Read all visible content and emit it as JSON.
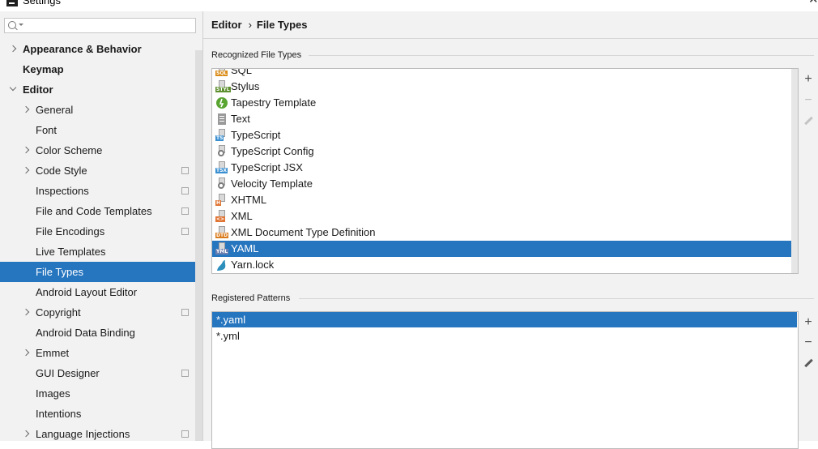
{
  "window": {
    "title": "Settings",
    "close_glyph": "✕"
  },
  "search": {
    "placeholder": "",
    "value": ""
  },
  "sidebar": {
    "items": [
      {
        "label": "Appearance & Behavior",
        "bold": true,
        "chevron": "right",
        "indent": 0,
        "proj": false
      },
      {
        "label": "Keymap",
        "bold": true,
        "chevron": "none",
        "indent": 0,
        "proj": false
      },
      {
        "label": "Editor",
        "bold": true,
        "chevron": "down",
        "indent": 0,
        "proj": false
      },
      {
        "label": "General",
        "bold": false,
        "chevron": "right",
        "indent": 1,
        "proj": false
      },
      {
        "label": "Font",
        "bold": false,
        "chevron": "none",
        "indent": 1,
        "proj": false
      },
      {
        "label": "Color Scheme",
        "bold": false,
        "chevron": "right",
        "indent": 1,
        "proj": false
      },
      {
        "label": "Code Style",
        "bold": false,
        "chevron": "right",
        "indent": 1,
        "proj": true
      },
      {
        "label": "Inspections",
        "bold": false,
        "chevron": "none",
        "indent": 1,
        "proj": true
      },
      {
        "label": "File and Code Templates",
        "bold": false,
        "chevron": "none",
        "indent": 1,
        "proj": true
      },
      {
        "label": "File Encodings",
        "bold": false,
        "chevron": "none",
        "indent": 1,
        "proj": true
      },
      {
        "label": "Live Templates",
        "bold": false,
        "chevron": "none",
        "indent": 1,
        "proj": false
      },
      {
        "label": "File Types",
        "bold": false,
        "chevron": "none",
        "indent": 1,
        "proj": false,
        "selected": true
      },
      {
        "label": "Android Layout Editor",
        "bold": false,
        "chevron": "none",
        "indent": 1,
        "proj": false
      },
      {
        "label": "Copyright",
        "bold": false,
        "chevron": "right",
        "indent": 1,
        "proj": true
      },
      {
        "label": "Android Data Binding",
        "bold": false,
        "chevron": "none",
        "indent": 1,
        "proj": false
      },
      {
        "label": "Emmet",
        "bold": false,
        "chevron": "right",
        "indent": 1,
        "proj": false
      },
      {
        "label": "GUI Designer",
        "bold": false,
        "chevron": "none",
        "indent": 1,
        "proj": true
      },
      {
        "label": "Images",
        "bold": false,
        "chevron": "none",
        "indent": 1,
        "proj": false
      },
      {
        "label": "Intentions",
        "bold": false,
        "chevron": "none",
        "indent": 1,
        "proj": false
      },
      {
        "label": "Language Injections",
        "bold": false,
        "chevron": "right",
        "indent": 1,
        "proj": true
      }
    ]
  },
  "breadcrumb": {
    "parent": "Editor",
    "separator": "›",
    "current": "File Types"
  },
  "recognized": {
    "title": "Recognized File Types",
    "items": [
      {
        "label": "SQL",
        "icon": "sql-file-icon",
        "tag": "SQL",
        "tag_color": "#d98b16"
      },
      {
        "label": "Stylus",
        "icon": "stylus-file-icon",
        "tag": "STYL",
        "tag_color": "#5d8f2f"
      },
      {
        "label": "Tapestry Template",
        "icon": "tapestry-icon",
        "tag": "",
        "tag_color": "#5aa532"
      },
      {
        "label": "Text",
        "icon": "text-file-icon",
        "tag": "",
        "tag_color": ""
      },
      {
        "label": "TypeScript",
        "icon": "typescript-file-icon",
        "tag": "TS",
        "tag_color": "#3a8fd1"
      },
      {
        "label": "TypeScript Config",
        "icon": "tsconfig-file-icon",
        "tag": "",
        "tag_color": ""
      },
      {
        "label": "TypeScript JSX",
        "icon": "tsx-file-icon",
        "tag": "TSX",
        "tag_color": "#3a8fd1"
      },
      {
        "label": "Velocity Template",
        "icon": "velocity-file-icon",
        "tag": "",
        "tag_color": ""
      },
      {
        "label": "XHTML",
        "icon": "xhtml-file-icon",
        "tag": "H",
        "tag_color": "#e07534"
      },
      {
        "label": "XML",
        "icon": "xml-file-icon",
        "tag": "<>",
        "tag_color": "#e07534"
      },
      {
        "label": "XML Document Type Definition",
        "icon": "dtd-file-icon",
        "tag": "DTD",
        "tag_color": "#d97a1b"
      },
      {
        "label": "YAML",
        "icon": "yaml-file-icon",
        "tag": "YML",
        "tag_color": "#6b7fb0",
        "selected": true
      },
      {
        "label": "Yarn.lock",
        "icon": "yarn-icon",
        "tag": "",
        "tag_color": "#2c8ebb"
      }
    ],
    "add_glyph": "+",
    "remove_glyph": "−"
  },
  "patterns": {
    "title": "Registered Patterns",
    "items": [
      {
        "label": "*.yaml",
        "selected": true
      },
      {
        "label": "*.yml"
      }
    ],
    "add_glyph": "+",
    "remove_glyph": "−"
  },
  "colors": {
    "selection": "#2675bf",
    "sidebar_bg": "#f2f2f2",
    "panel_bg": "#f2f2f2"
  }
}
